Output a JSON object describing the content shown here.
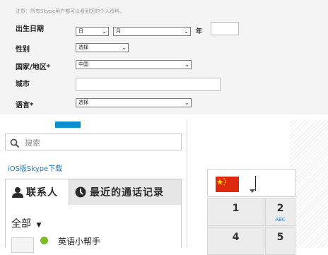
{
  "form": {
    "note": "注意：所有Skype用户都可以看到您的个人资料。",
    "birthdate": {
      "label": "出生日期",
      "day": "日",
      "month": "月",
      "year_label": "年",
      "year_value": ""
    },
    "gender": {
      "label": "性别",
      "value": "选择"
    },
    "country": {
      "label": "国家/地区*",
      "value": "中国"
    },
    "city": {
      "label": "城市",
      "value": ""
    },
    "language": {
      "label": "语言*",
      "value": "选择"
    }
  },
  "search": {
    "placeholder": "搜索",
    "icon": "search-icon"
  },
  "ios_link": "iOS版Skype下载",
  "tabs": [
    {
      "label": "联系人",
      "icon": "person-icon"
    },
    {
      "label": "最近的通话记录",
      "icon": "clock-icon"
    }
  ],
  "filter": {
    "label": "全部",
    "icon": "caret-down-icon"
  },
  "contacts": [
    {
      "name": "英语小帮手",
      "status_color": "#7ebc2a"
    }
  ],
  "dialpad": {
    "country_flag": "china-flag-icon",
    "keys": [
      {
        "digit": "1",
        "letters": ""
      },
      {
        "digit": "2",
        "letters": "ABC"
      },
      {
        "digit": "4",
        "letters": ""
      },
      {
        "digit": "5",
        "letters": ""
      }
    ]
  },
  "colors": {
    "accent": "#0d8ecf",
    "link": "#1a7fc4",
    "online": "#7ebc2a"
  }
}
